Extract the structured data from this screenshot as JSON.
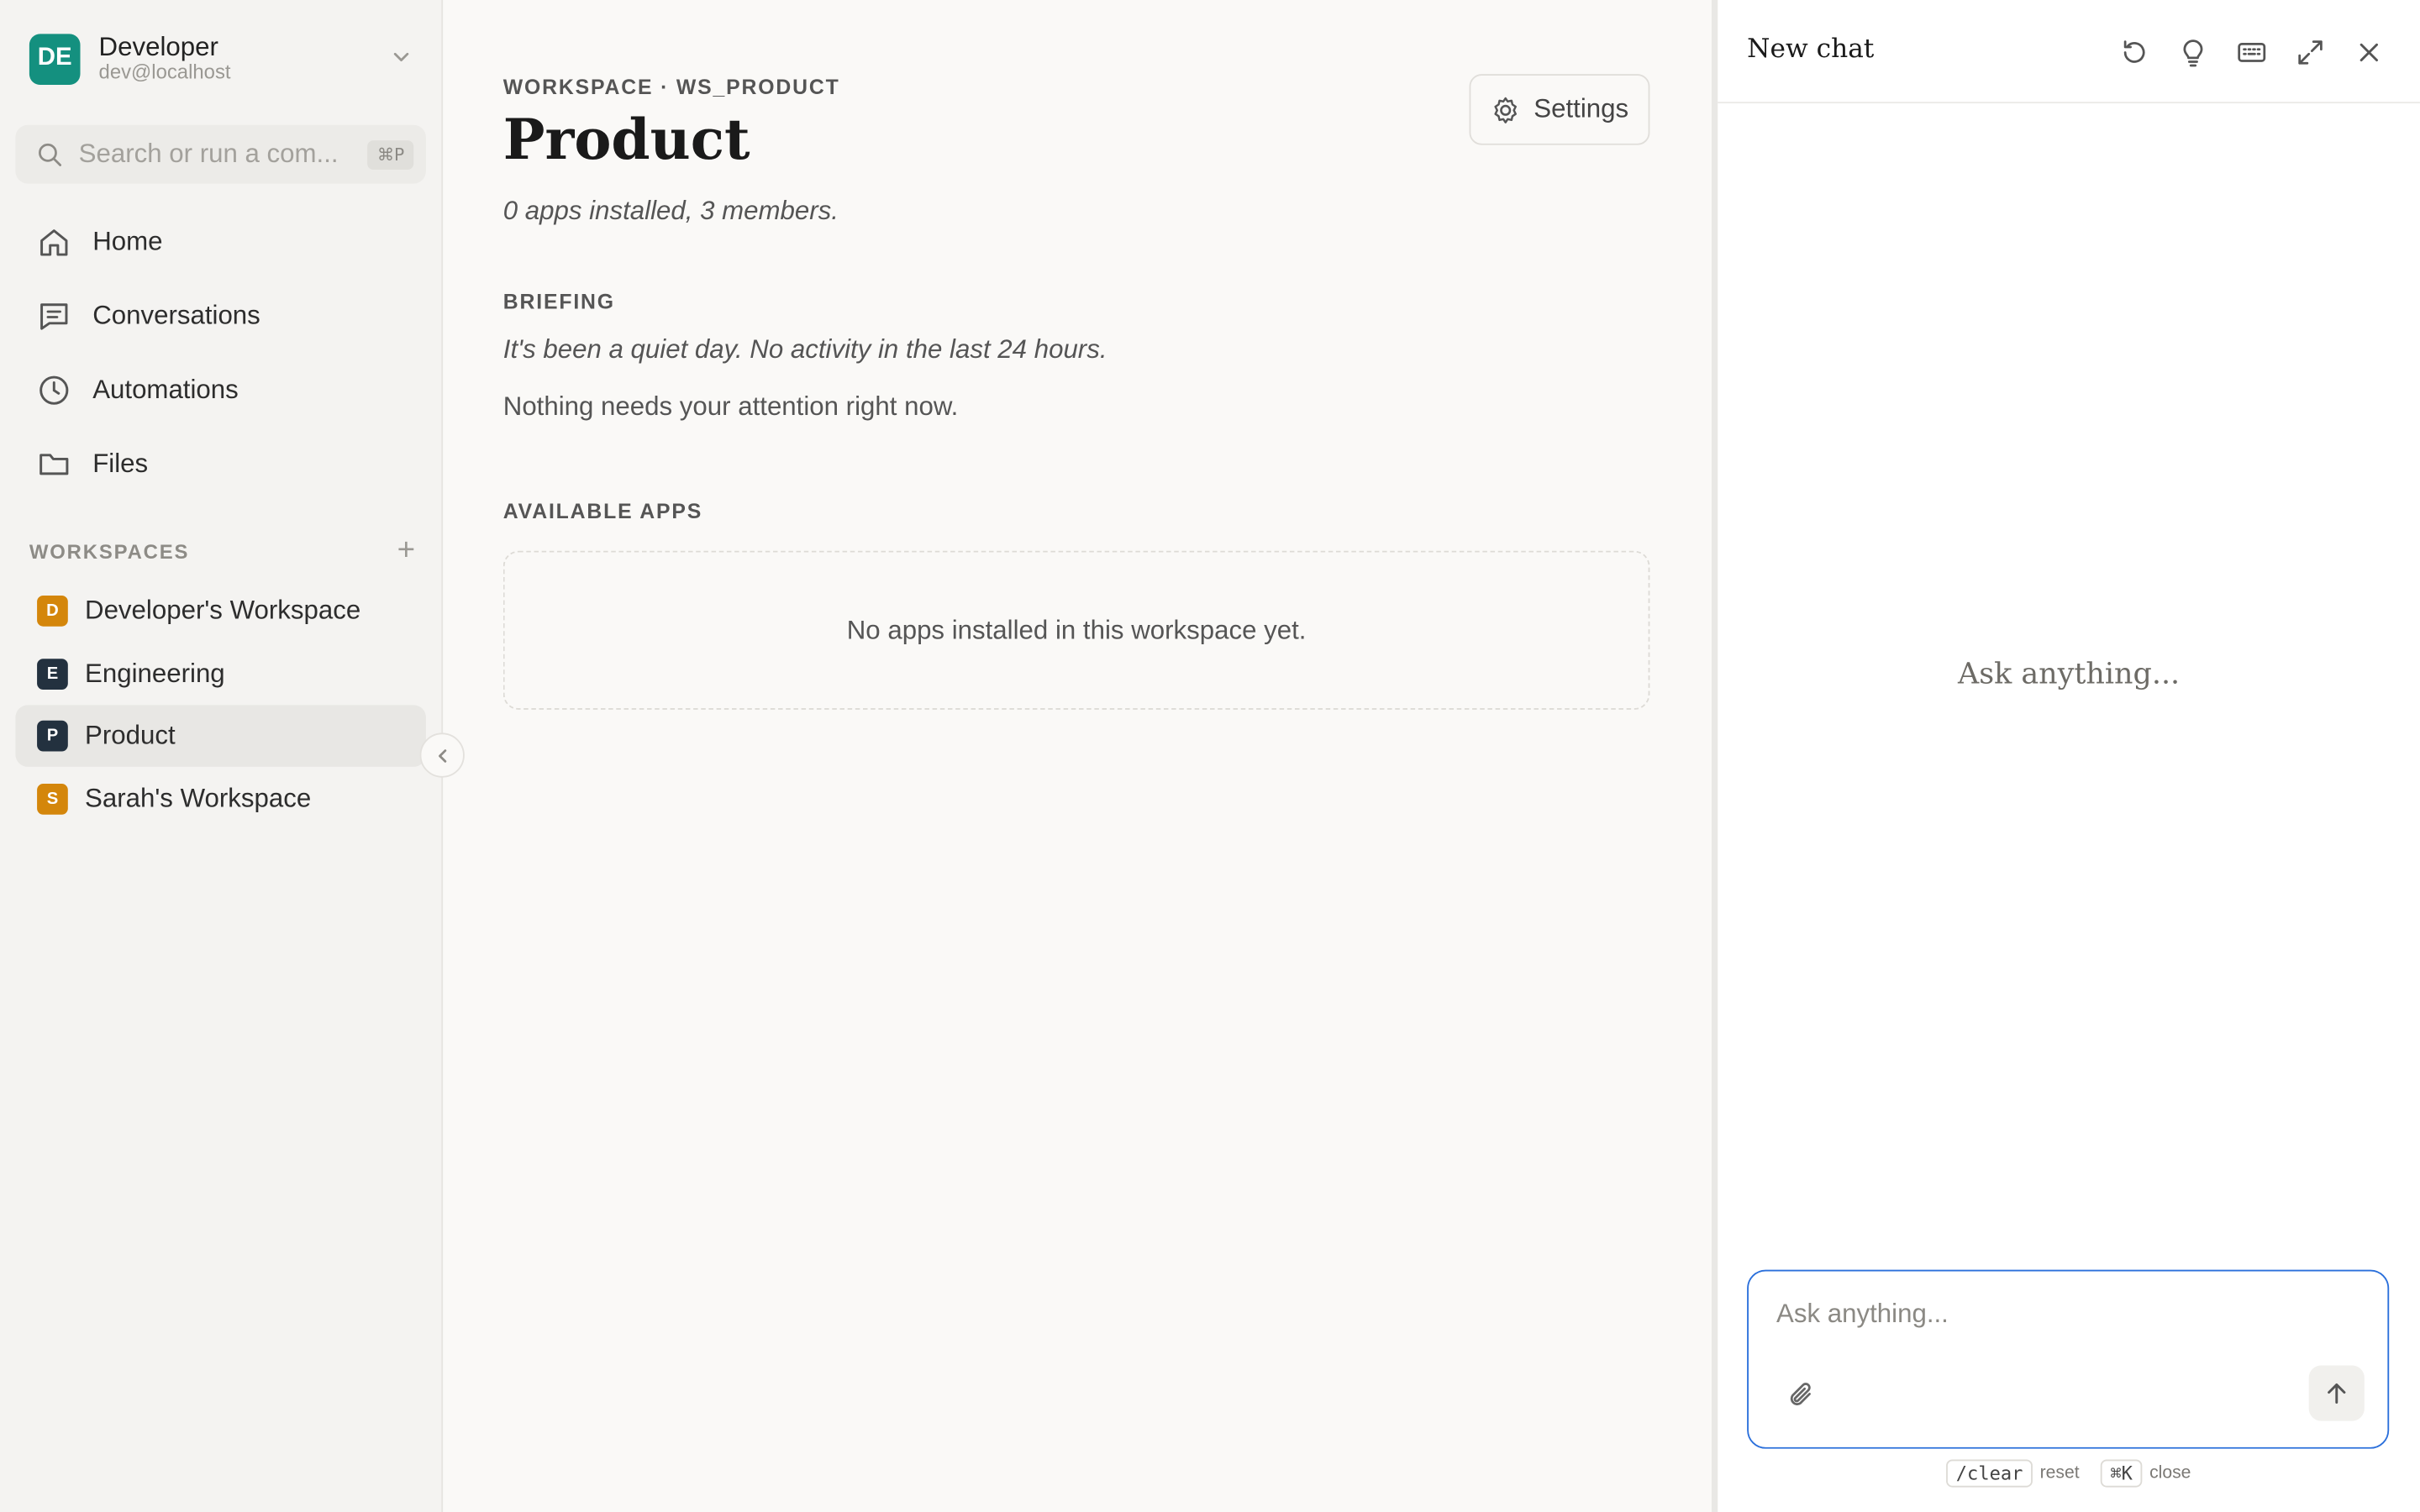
{
  "account": {
    "initials": "DE",
    "name": "Developer",
    "email": "dev@localhost",
    "avatar_color": "#14907f"
  },
  "search": {
    "placeholder": "Search or run a com...",
    "shortcut": "⌘P"
  },
  "nav": {
    "items": [
      {
        "label": "Home",
        "icon": "home-icon"
      },
      {
        "label": "Conversations",
        "icon": "conversations-icon"
      },
      {
        "label": "Automations",
        "icon": "clock-icon"
      },
      {
        "label": "Files",
        "icon": "folder-icon"
      }
    ]
  },
  "workspaces": {
    "title": "WORKSPACES",
    "add_label": "+",
    "items": [
      {
        "initial": "D",
        "label": "Developer's Workspace",
        "color": "#d4860b"
      },
      {
        "initial": "E",
        "label": "Engineering",
        "color": "#23313f"
      },
      {
        "initial": "P",
        "label": "Product",
        "color": "#23313f",
        "active": true
      },
      {
        "initial": "S",
        "label": "Sarah's Workspace",
        "color": "#d4860b"
      }
    ]
  },
  "main": {
    "eyebrow": "WORKSPACE · WS_PRODUCT",
    "title": "Product",
    "subtitle": "0 apps installed, 3 members.",
    "settings_label": "Settings",
    "briefing": {
      "label": "BRIEFING",
      "line1": "It's been a quiet day. No activity in the last 24 hours.",
      "line2": "Nothing needs your attention right now."
    },
    "apps": {
      "label": "AVAILABLE APPS",
      "empty": "No apps installed in this workspace yet."
    }
  },
  "chat": {
    "title": "New chat",
    "empty_prompt": "Ask anything...",
    "input_placeholder": "Ask anything...",
    "hints": [
      {
        "key": "/clear",
        "label": "reset"
      },
      {
        "key": "⌘K",
        "label": "close"
      }
    ],
    "accent": "#2a6fdb"
  }
}
